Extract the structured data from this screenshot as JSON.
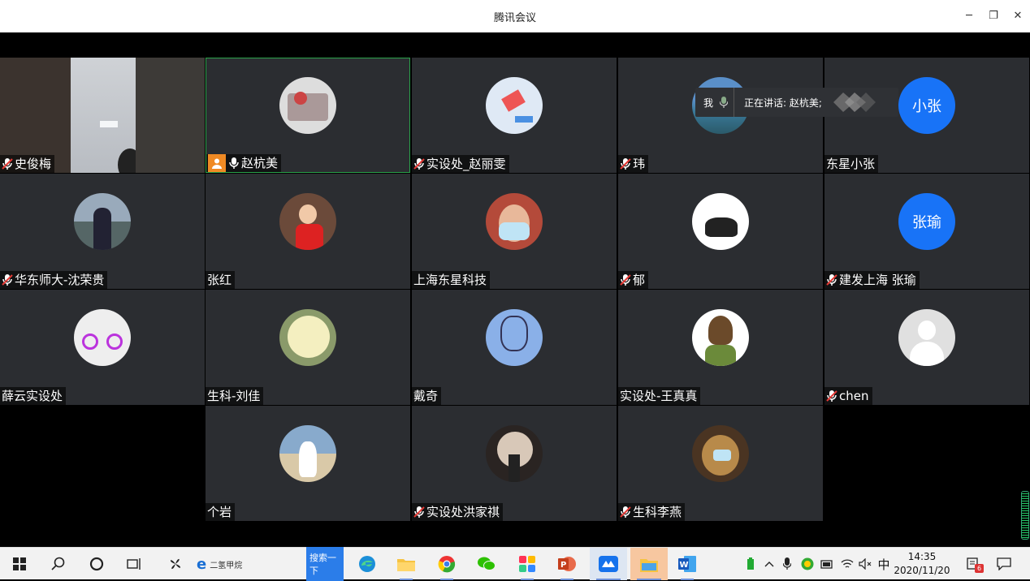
{
  "window": {
    "title": "腾讯会议",
    "minimize": "─",
    "restore": "❐",
    "close": "✕"
  },
  "speaking": {
    "me": "我",
    "label": "正在讲话: 赵杭美;"
  },
  "participants": [
    {
      "name": "史俊梅",
      "muted": true
    },
    {
      "name": "赵杭美",
      "muted": false,
      "host": true
    },
    {
      "name": "实设处_赵丽雯",
      "muted": true
    },
    {
      "name": "玮",
      "muted": true
    },
    {
      "name": "东星小张",
      "muted": false,
      "avatar_text": "小张"
    },
    {
      "name": "华东师大-沈荣贵",
      "muted": true
    },
    {
      "name": "张红",
      "muted": false
    },
    {
      "name": "上海东星科技",
      "muted": false
    },
    {
      "name": "郁",
      "muted": true
    },
    {
      "name": "建发上海 张瑜",
      "muted": true,
      "avatar_text": "张瑜"
    },
    {
      "name": "薛云实设处",
      "muted": false
    },
    {
      "name": "生科-刘佳",
      "muted": false
    },
    {
      "name": "戴奇",
      "muted": false
    },
    {
      "name": "实设处-王真真",
      "muted": false
    },
    {
      "name": "chen",
      "muted": true
    },
    {
      "name": "个岩",
      "muted": false
    },
    {
      "name": "实设处洪家祺",
      "muted": true
    },
    {
      "name": "生科李燕",
      "muted": true
    }
  ],
  "taskbar": {
    "search_button": "搜索一下",
    "browser_tab": "二氢甲烷",
    "ime": "中",
    "time": "14:35",
    "date": "2020/11/20",
    "notification_count": "6"
  },
  "colors": {
    "accent": "#1873f7",
    "active_border": "#2aa24a",
    "host_badge": "#f08a24",
    "tile_bg": "#2b2d31"
  }
}
